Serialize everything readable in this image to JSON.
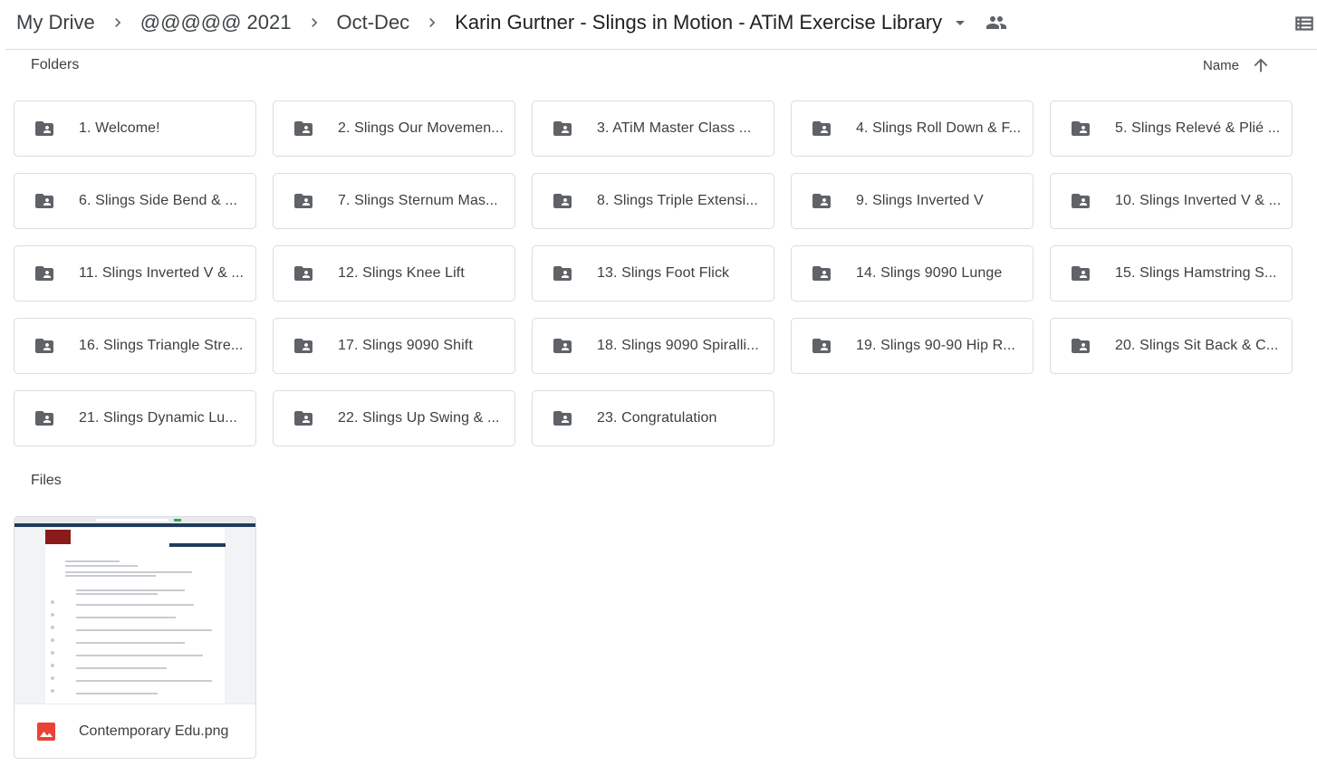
{
  "breadcrumb": {
    "items": [
      "My Drive",
      "@@@@@ 2021",
      "Oct-Dec",
      "Karin Gurtner - Slings in Motion - ATiM Exercise Library"
    ]
  },
  "icons": {
    "separator": "chevron-right-icon",
    "dropdown": "arrow-drop-down-icon",
    "shared": "people-icon",
    "list_view": "list-view-icon",
    "sort": "arrow-upward-icon",
    "folder": "shared-folder-icon",
    "file": "image-file-icon"
  },
  "colors": {
    "icon_gray": "#5f6368",
    "border": "#dadce0",
    "image_red": "#ea4335"
  },
  "folders_section": {
    "label": "Folders",
    "sort_label": "Name",
    "items": [
      "1. Welcome!",
      "2. Slings Our Movemen...",
      "3. ATiM Master Class ...",
      "4. Slings Roll Down & F...",
      "5. Slings Relevé & Plié ...",
      "6. Slings Side Bend & ...",
      "7. Slings Sternum Mas...",
      "8. Slings Triple Extensi...",
      "9. Slings Inverted V",
      "10. Slings Inverted V & ...",
      "11. Slings Inverted V & ...",
      "12. Slings Knee Lift",
      "13. Slings Foot Flick",
      "14. Slings 9090 Lunge",
      "15. Slings Hamstring S...",
      "16. Slings Triangle Stre...",
      "17. Slings 9090 Shift",
      "18. Slings 9090 Spiralli...",
      "19. Slings 90-90 Hip R...",
      "20. Slings Sit Back & C...",
      "21. Slings Dynamic Lu...",
      "22. Slings Up Swing & ...",
      "23. Congratulation"
    ]
  },
  "files_section": {
    "label": "Files",
    "items": [
      {
        "name": "Contemporary Edu.png"
      }
    ]
  }
}
